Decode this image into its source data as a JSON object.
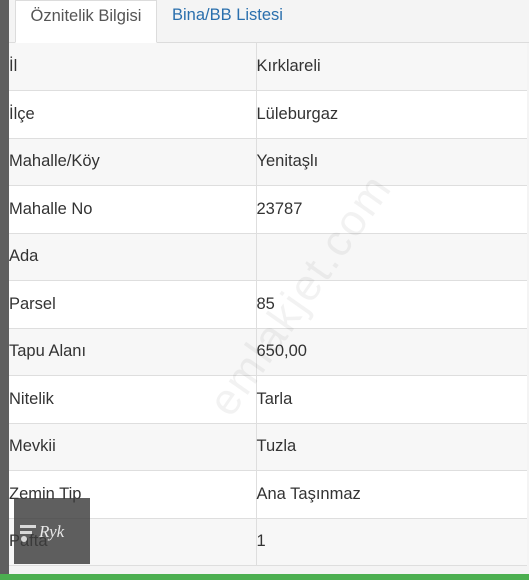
{
  "tabs": [
    {
      "label": "Öznitelik Bilgisi",
      "active": true
    },
    {
      "label": "Bina/BB Listesi",
      "active": false
    }
  ],
  "rows": [
    {
      "label": "İl",
      "value": "Kırklareli"
    },
    {
      "label": "İlçe",
      "value": "Lüleburgaz"
    },
    {
      "label": "Mahalle/Köy",
      "value": "Yenitaşlı"
    },
    {
      "label": "Mahalle No",
      "value": "23787"
    },
    {
      "label": "Ada",
      "value": ""
    },
    {
      "label": "Parsel",
      "value": "85"
    },
    {
      "label": "Tapu Alanı",
      "value": "650,00"
    },
    {
      "label": "Nitelik",
      "value": "Tarla"
    },
    {
      "label": "Mevkii",
      "value": "Tuzla"
    },
    {
      "label": "Zemin Tip",
      "value": "Ana Taşınmaz"
    },
    {
      "label": "Pafta",
      "value": "1"
    }
  ],
  "watermark": "emlakjet.com",
  "logo_text": "Ryk",
  "colors": {
    "tab_link": "#2a6fad",
    "bottom_bar": "#4caf50"
  }
}
